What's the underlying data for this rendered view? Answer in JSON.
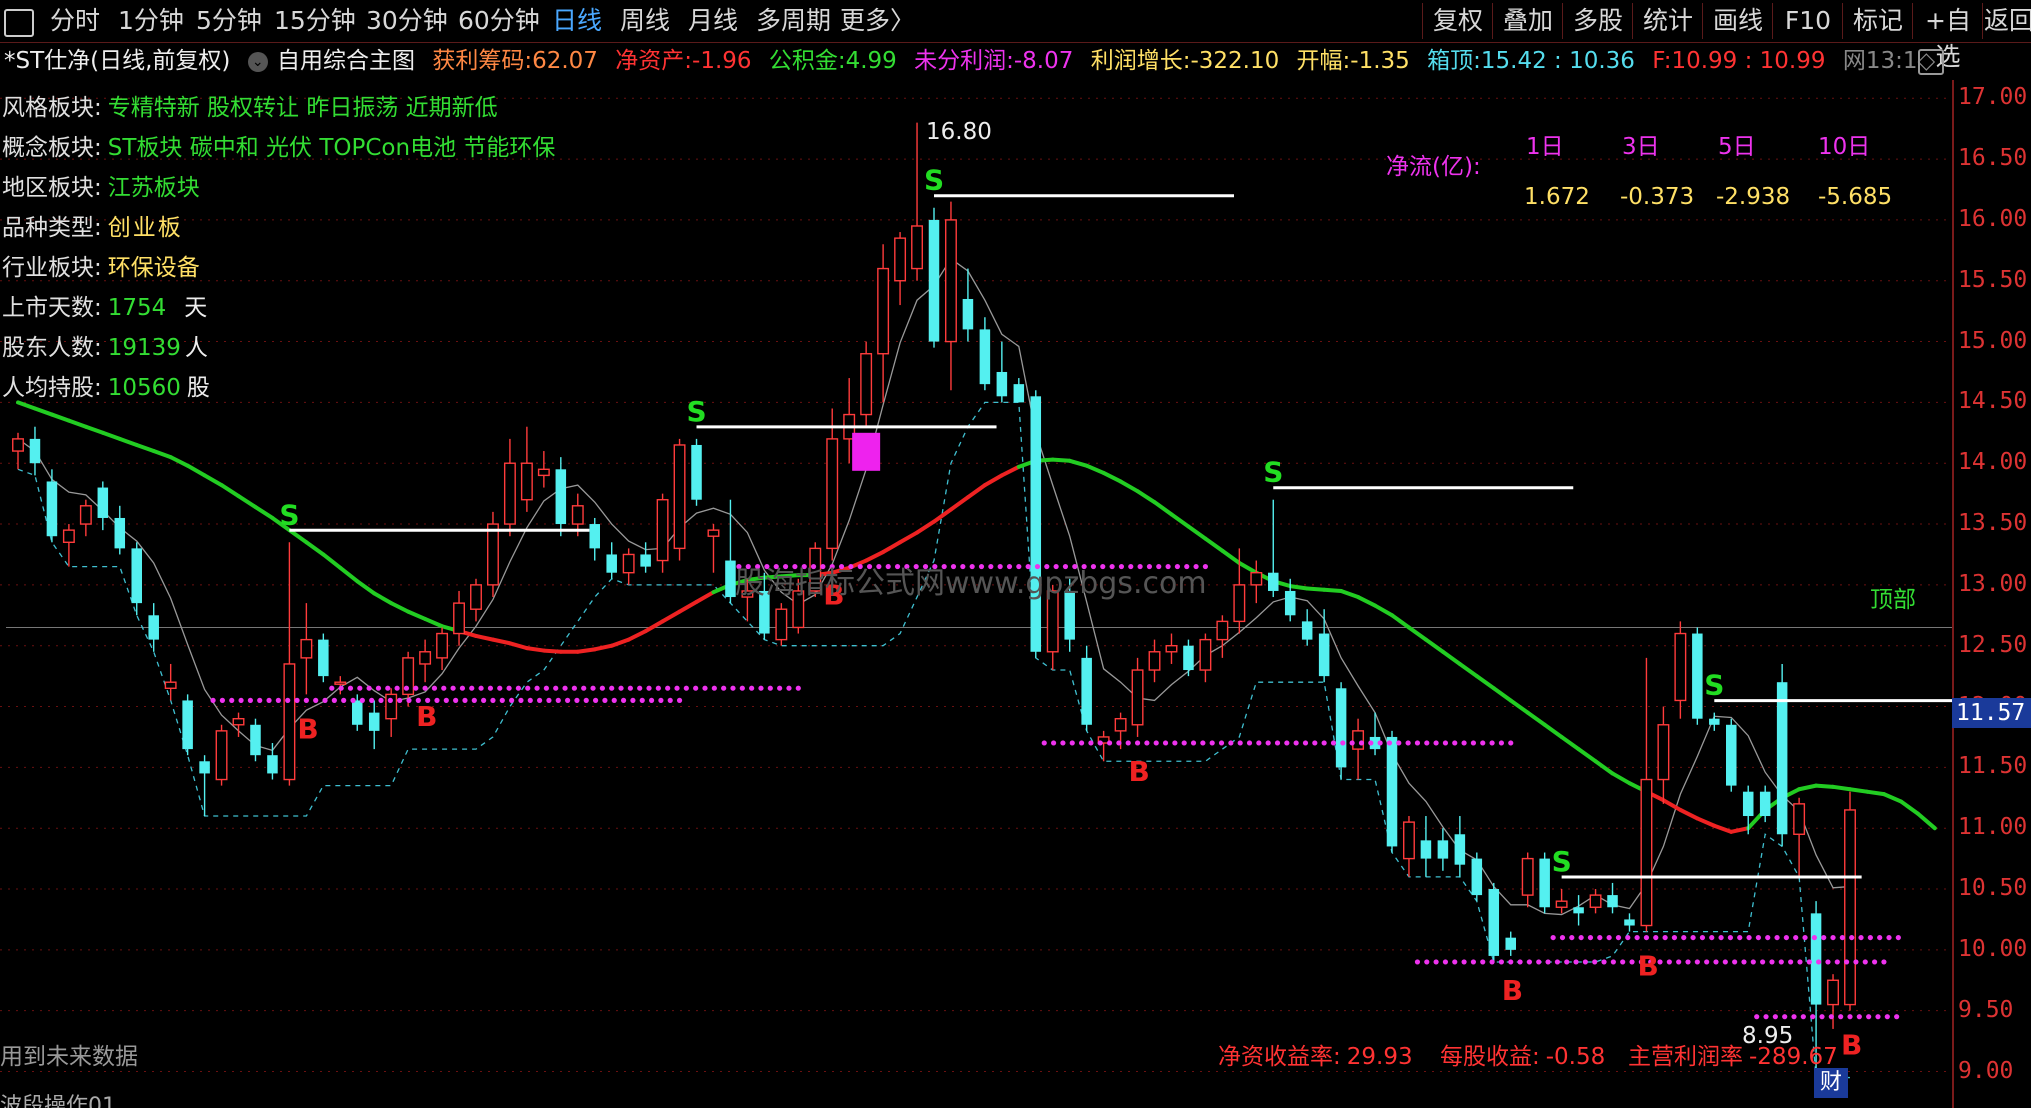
{
  "toolbar": {
    "periods": [
      "分时",
      "1分钟",
      "5分钟",
      "15分钟",
      "30分钟",
      "60分钟",
      "日线",
      "周线",
      "月线",
      "多周期",
      "更多〉"
    ],
    "active_period": "日线",
    "right_buttons": [
      "复权",
      "叠加",
      "多股",
      "统计",
      "画线",
      "F10",
      "标记",
      "+自选",
      "返回"
    ]
  },
  "info": {
    "stock_title": "*ST仕净(日线,前复权)",
    "indicator": "自用综合主图",
    "profit_chips_label": "获利筹码:",
    "profit_chips": "62.07",
    "net_assets_label": "净资产:",
    "net_assets": "-1.96",
    "reserve_label": "公积金:",
    "reserve": "4.99",
    "undistributed_label": "未分利润:",
    "undistributed": "-8.07",
    "profit_growth_label": "利润增长:",
    "profit_growth": "-322.10",
    "open_amp_label": "开幅:",
    "open_amp": "-1.35",
    "box_top_label": "箱顶:",
    "box_top": "15.42 : 10.36",
    "f_label": "F:",
    "f_value": "10.99 : 10.99",
    "extra": "网13:1◇"
  },
  "left_panel": {
    "style_label": "风格板块:",
    "style_value": "专精特新 股权转让 昨日振荡 近期新低",
    "concept_label": "概念板块:",
    "concept_value": "ST板块 碳中和 光伏 TOPCon电池 节能环保",
    "region_label": "地区板块:",
    "region_value": "江苏板块",
    "type_label": "品种类型:",
    "type_value": "创业板",
    "industry_label": "行业板块:",
    "industry_value": "环保设备",
    "days_label": "上市天数:",
    "days_value": "1754",
    "days_unit": "天",
    "holders_label": "股东人数:",
    "holders_value": "19139",
    "holders_unit": "人",
    "per_label": "人均持股:",
    "per_value": "10560",
    "per_unit": "股"
  },
  "net_flow": {
    "label": "净流(亿):",
    "headers": [
      "1日",
      "3日",
      "5日",
      "10日"
    ],
    "values": [
      "1.672",
      "-0.373",
      "-2.938",
      "-5.685"
    ]
  },
  "annotations": {
    "high_price": "16.80",
    "low_price": "8.95",
    "current_price": "11.57",
    "top_label": "顶部",
    "future_data_note": "用到未来数据",
    "watermark": "股海指标公式网www.gpzbgs.com",
    "fin_badge": "财",
    "bottom_tab": "波段操作01"
  },
  "bottom_stats": {
    "roe_label": "净资收益率:",
    "roe": "29.93",
    "eps_label": "每股收益:",
    "eps": "-0.58",
    "margin_label": "主营利润率",
    "margin": "-289.67"
  },
  "y_axis": {
    "ticks": [
      "17.00",
      "16.50",
      "16.00",
      "15.50",
      "15.00",
      "14.50",
      "14.00",
      "13.50",
      "13.00",
      "12.50",
      "12.00",
      "11.50",
      "11.00",
      "10.50",
      "10.00",
      "9.50",
      "9.00"
    ]
  },
  "chart_data": {
    "type": "candlestick",
    "ylim": [
      8.7,
      17.15
    ],
    "candles": [
      {
        "o": 14.1,
        "h": 14.25,
        "l": 13.95,
        "c": 14.2
      },
      {
        "o": 14.2,
        "h": 14.3,
        "l": 13.9,
        "c": 14.0
      },
      {
        "o": 13.85,
        "h": 13.95,
        "l": 13.35,
        "c": 13.4
      },
      {
        "o": 13.35,
        "h": 13.5,
        "l": 13.15,
        "c": 13.45
      },
      {
        "o": 13.5,
        "h": 13.7,
        "l": 13.4,
        "c": 13.65
      },
      {
        "o": 13.8,
        "h": 13.85,
        "l": 13.45,
        "c": 13.55
      },
      {
        "o": 13.55,
        "h": 13.65,
        "l": 13.25,
        "c": 13.3
      },
      {
        "o": 13.3,
        "h": 13.35,
        "l": 12.75,
        "c": 12.85
      },
      {
        "o": 12.75,
        "h": 12.85,
        "l": 12.45,
        "c": 12.55
      },
      {
        "o": 12.15,
        "h": 12.35,
        "l": 12.05,
        "c": 12.2
      },
      {
        "o": 12.05,
        "h": 12.1,
        "l": 11.6,
        "c": 11.65
      },
      {
        "o": 11.55,
        "h": 11.6,
        "l": 11.1,
        "c": 11.45
      },
      {
        "o": 11.4,
        "h": 11.85,
        "l": 11.35,
        "c": 11.8
      },
      {
        "o": 11.85,
        "h": 11.95,
        "l": 11.75,
        "c": 11.9
      },
      {
        "o": 11.85,
        "h": 11.9,
        "l": 11.55,
        "c": 11.6
      },
      {
        "o": 11.6,
        "h": 11.7,
        "l": 11.4,
        "c": 11.45
      },
      {
        "o": 11.4,
        "h": 13.35,
        "l": 11.35,
        "c": 12.35
      },
      {
        "o": 12.4,
        "h": 12.85,
        "l": 12.1,
        "c": 12.55
      },
      {
        "o": 12.55,
        "h": 12.6,
        "l": 12.2,
        "c": 12.25
      },
      {
        "o": 12.2,
        "h": 12.25,
        "l": 12.1,
        "c": 12.2
      },
      {
        "o": 12.05,
        "h": 12.1,
        "l": 11.8,
        "c": 11.85
      },
      {
        "o": 11.95,
        "h": 12.05,
        "l": 11.65,
        "c": 11.8
      },
      {
        "o": 11.9,
        "h": 12.15,
        "l": 11.75,
        "c": 12.1
      },
      {
        "o": 12.1,
        "h": 12.45,
        "l": 12.0,
        "c": 12.4
      },
      {
        "o": 12.35,
        "h": 12.55,
        "l": 12.2,
        "c": 12.45
      },
      {
        "o": 12.4,
        "h": 12.65,
        "l": 12.3,
        "c": 12.6
      },
      {
        "o": 12.6,
        "h": 12.95,
        "l": 12.5,
        "c": 12.85
      },
      {
        "o": 12.8,
        "h": 13.05,
        "l": 12.7,
        "c": 13.0
      },
      {
        "o": 13.0,
        "h": 13.6,
        "l": 12.9,
        "c": 13.5
      },
      {
        "o": 13.5,
        "h": 14.2,
        "l": 13.4,
        "c": 14.0
      },
      {
        "o": 13.7,
        "h": 14.3,
        "l": 13.6,
        "c": 14.0
      },
      {
        "o": 13.9,
        "h": 14.1,
        "l": 13.8,
        "c": 13.95
      },
      {
        "o": 13.95,
        "h": 14.05,
        "l": 13.4,
        "c": 13.5
      },
      {
        "o": 13.5,
        "h": 13.75,
        "l": 13.4,
        "c": 13.65
      },
      {
        "o": 13.5,
        "h": 13.55,
        "l": 13.2,
        "c": 13.3
      },
      {
        "o": 13.25,
        "h": 13.35,
        "l": 13.05,
        "c": 13.1
      },
      {
        "o": 13.1,
        "h": 13.3,
        "l": 13.0,
        "c": 13.25
      },
      {
        "o": 13.25,
        "h": 13.35,
        "l": 13.1,
        "c": 13.15
      },
      {
        "o": 13.2,
        "h": 13.75,
        "l": 13.1,
        "c": 13.7
      },
      {
        "o": 13.3,
        "h": 14.2,
        "l": 13.2,
        "c": 14.15
      },
      {
        "o": 14.15,
        "h": 14.2,
        "l": 13.65,
        "c": 13.7
      },
      {
        "o": 13.4,
        "h": 13.5,
        "l": 13.1,
        "c": 13.45
      },
      {
        "o": 13.2,
        "h": 13.7,
        "l": 12.85,
        "c": 12.9
      },
      {
        "o": 12.9,
        "h": 13.05,
        "l": 12.7,
        "c": 12.95
      },
      {
        "o": 12.95,
        "h": 13.1,
        "l": 12.55,
        "c": 12.6
      },
      {
        "o": 12.55,
        "h": 12.85,
        "l": 12.5,
        "c": 12.8
      },
      {
        "o": 12.65,
        "h": 13.05,
        "l": 12.6,
        "c": 12.95
      },
      {
        "o": 12.95,
        "h": 13.35,
        "l": 12.9,
        "c": 13.3
      },
      {
        "o": 13.3,
        "h": 14.45,
        "l": 13.2,
        "c": 14.2
      },
      {
        "o": 14.2,
        "h": 14.7,
        "l": 14.0,
        "c": 14.4
      },
      {
        "o": 14.4,
        "h": 15.0,
        "l": 14.3,
        "c": 14.9
      },
      {
        "o": 14.9,
        "h": 15.8,
        "l": 14.5,
        "c": 15.6
      },
      {
        "o": 15.5,
        "h": 15.9,
        "l": 15.3,
        "c": 15.85
      },
      {
        "o": 15.6,
        "h": 16.8,
        "l": 15.5,
        "c": 15.95
      },
      {
        "o": 16.0,
        "h": 16.1,
        "l": 14.95,
        "c": 15.0
      },
      {
        "o": 15.0,
        "h": 16.15,
        "l": 14.6,
        "c": 16.0
      },
      {
        "o": 15.35,
        "h": 15.6,
        "l": 15.0,
        "c": 15.1
      },
      {
        "o": 15.1,
        "h": 15.2,
        "l": 14.6,
        "c": 14.65
      },
      {
        "o": 14.75,
        "h": 15.0,
        "l": 14.5,
        "c": 14.55
      },
      {
        "o": 14.65,
        "h": 14.7,
        "l": 14.5,
        "c": 14.5
      },
      {
        "o": 14.55,
        "h": 14.6,
        "l": 12.4,
        "c": 12.45
      },
      {
        "o": 12.45,
        "h": 13.0,
        "l": 12.3,
        "c": 12.95
      },
      {
        "o": 12.95,
        "h": 13.05,
        "l": 12.45,
        "c": 12.55
      },
      {
        "o": 12.4,
        "h": 12.5,
        "l": 11.8,
        "c": 11.85
      },
      {
        "o": 11.7,
        "h": 11.8,
        "l": 11.55,
        "c": 11.75
      },
      {
        "o": 11.8,
        "h": 11.95,
        "l": 11.65,
        "c": 11.9
      },
      {
        "o": 11.85,
        "h": 12.4,
        "l": 11.75,
        "c": 12.3
      },
      {
        "o": 12.3,
        "h": 12.55,
        "l": 12.2,
        "c": 12.45
      },
      {
        "o": 12.45,
        "h": 12.6,
        "l": 12.35,
        "c": 12.5
      },
      {
        "o": 12.5,
        "h": 12.55,
        "l": 12.25,
        "c": 12.3
      },
      {
        "o": 12.3,
        "h": 12.6,
        "l": 12.2,
        "c": 12.55
      },
      {
        "o": 12.55,
        "h": 12.75,
        "l": 12.4,
        "c": 12.7
      },
      {
        "o": 12.7,
        "h": 13.3,
        "l": 12.6,
        "c": 13.0
      },
      {
        "o": 13.0,
        "h": 13.2,
        "l": 12.85,
        "c": 13.1
      },
      {
        "o": 13.1,
        "h": 13.7,
        "l": 12.9,
        "c": 12.95
      },
      {
        "o": 12.95,
        "h": 13.05,
        "l": 12.7,
        "c": 12.75
      },
      {
        "o": 12.7,
        "h": 12.8,
        "l": 12.5,
        "c": 12.55
      },
      {
        "o": 12.6,
        "h": 12.8,
        "l": 12.2,
        "c": 12.25
      },
      {
        "o": 12.15,
        "h": 12.2,
        "l": 11.4,
        "c": 11.5
      },
      {
        "o": 11.65,
        "h": 11.9,
        "l": 11.4,
        "c": 11.8
      },
      {
        "o": 11.75,
        "h": 11.95,
        "l": 11.6,
        "c": 11.65
      },
      {
        "o": 11.75,
        "h": 11.8,
        "l": 10.8,
        "c": 10.85
      },
      {
        "o": 10.75,
        "h": 11.1,
        "l": 10.6,
        "c": 11.05
      },
      {
        "o": 10.9,
        "h": 11.1,
        "l": 10.6,
        "c": 10.75
      },
      {
        "o": 10.9,
        "h": 11.0,
        "l": 10.65,
        "c": 10.75
      },
      {
        "o": 10.95,
        "h": 11.1,
        "l": 10.6,
        "c": 10.7
      },
      {
        "o": 10.75,
        "h": 10.8,
        "l": 10.4,
        "c": 10.45
      },
      {
        "o": 10.5,
        "h": 10.55,
        "l": 9.9,
        "c": 9.95
      },
      {
        "o": 10.1,
        "h": 10.15,
        "l": 9.95,
        "c": 10.0
      },
      {
        "o": 10.45,
        "h": 10.8,
        "l": 10.35,
        "c": 10.75
      },
      {
        "o": 10.75,
        "h": 10.8,
        "l": 10.3,
        "c": 10.35
      },
      {
        "o": 10.35,
        "h": 10.5,
        "l": 10.3,
        "c": 10.4
      },
      {
        "o": 10.35,
        "h": 10.45,
        "l": 10.2,
        "c": 10.3
      },
      {
        "o": 10.35,
        "h": 10.5,
        "l": 10.3,
        "c": 10.45
      },
      {
        "o": 10.45,
        "h": 10.55,
        "l": 10.3,
        "c": 10.35
      },
      {
        "o": 10.25,
        "h": 10.3,
        "l": 10.15,
        "c": 10.2
      },
      {
        "o": 10.2,
        "h": 12.4,
        "l": 10.15,
        "c": 11.4
      },
      {
        "o": 11.4,
        "h": 12.0,
        "l": 11.2,
        "c": 11.85
      },
      {
        "o": 12.05,
        "h": 12.7,
        "l": 11.9,
        "c": 12.6
      },
      {
        "o": 12.6,
        "h": 12.65,
        "l": 11.85,
        "c": 11.9
      },
      {
        "o": 11.9,
        "h": 11.95,
        "l": 11.8,
        "c": 11.85
      },
      {
        "o": 11.85,
        "h": 11.9,
        "l": 11.3,
        "c": 11.35
      },
      {
        "o": 11.3,
        "h": 11.35,
        "l": 10.95,
        "c": 11.1
      },
      {
        "o": 11.3,
        "h": 11.35,
        "l": 11.05,
        "c": 11.1
      },
      {
        "o": 12.2,
        "h": 12.35,
        "l": 10.85,
        "c": 10.95
      },
      {
        "o": 10.95,
        "h": 11.25,
        "l": 10.6,
        "c": 11.2
      },
      {
        "o": 10.3,
        "h": 10.4,
        "l": 8.95,
        "c": 9.55
      },
      {
        "o": 9.55,
        "h": 9.8,
        "l": 9.35,
        "c": 9.75
      },
      {
        "o": 9.55,
        "h": 11.3,
        "l": 9.5,
        "c": 11.15
      }
    ],
    "green_ma": [
      14.5,
      14.45,
      14.4,
      14.35,
      14.3,
      14.25,
      14.2,
      14.15,
      14.1,
      14.05,
      13.98,
      13.9,
      13.82,
      13.73,
      13.64,
      13.55,
      13.45,
      13.35,
      13.25,
      13.14,
      13.03,
      12.93,
      12.85,
      12.78,
      12.72,
      12.66,
      12.62,
      12.58,
      12.55,
      12.52,
      12.48,
      12.46,
      12.45,
      12.45,
      12.47,
      12.5,
      12.55,
      12.62,
      12.7,
      12.78,
      12.86,
      12.94,
      13.0,
      13.04,
      13.06,
      13.07,
      13.08,
      13.08,
      13.1,
      13.14,
      13.2,
      13.27,
      13.35,
      13.43,
      13.52,
      13.62,
      13.72,
      13.82,
      13.9,
      13.97,
      14.02,
      14.03,
      14.02,
      13.98,
      13.92,
      13.85,
      13.77,
      13.68,
      13.58,
      13.48,
      13.38,
      13.28,
      13.18,
      13.1,
      13.03,
      12.99,
      12.97,
      12.96,
      12.95,
      12.9,
      12.83,
      12.75,
      12.65,
      12.55,
      12.45,
      12.35,
      12.25,
      12.15,
      12.05,
      11.95,
      11.85,
      11.75,
      11.65,
      11.55,
      11.45,
      11.37,
      11.3,
      11.23,
      11.15,
      11.08,
      11.02,
      10.97,
      11.0,
      11.15,
      11.25,
      11.32,
      11.35,
      11.34,
      11.32,
      11.3,
      11.28,
      11.22,
      11.12,
      11.0
    ],
    "signals": [
      {
        "type": "S",
        "i": 16
      },
      {
        "type": "S",
        "i": 40
      },
      {
        "type": "S",
        "i": 54
      },
      {
        "type": "S",
        "i": 74
      },
      {
        "type": "S",
        "i": 91
      },
      {
        "type": "S",
        "i": 100
      },
      {
        "type": "B",
        "i": 17
      },
      {
        "type": "B",
        "i": 24
      },
      {
        "type": "B",
        "i": 48
      },
      {
        "type": "B",
        "i": 66
      },
      {
        "type": "B",
        "i": 88
      },
      {
        "type": "B",
        "i": 96
      },
      {
        "type": "B",
        "i": 108
      }
    ]
  }
}
